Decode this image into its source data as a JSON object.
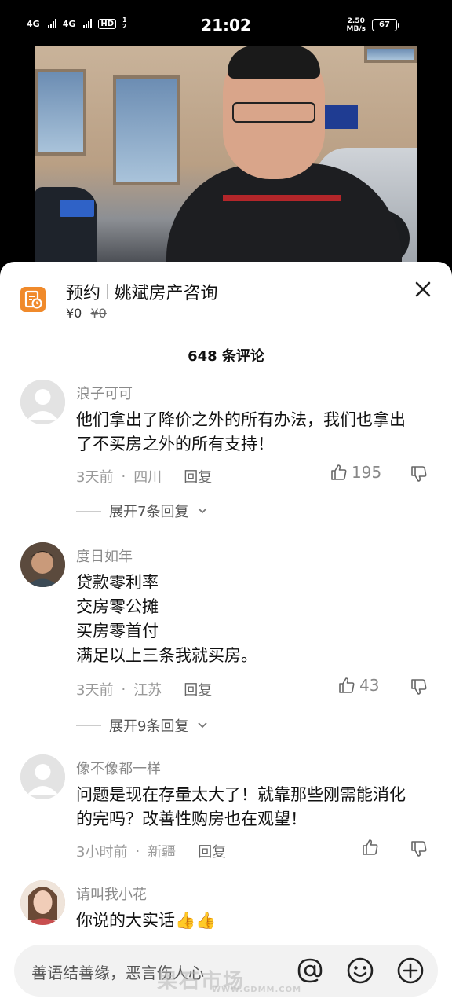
{
  "status_bar": {
    "sim1": "4G",
    "sim2": "4G",
    "hd": "HD",
    "hd_sub": "1 2",
    "time": "21:02",
    "net_speed": "2.50",
    "net_unit": "MB/s",
    "battery": "67"
  },
  "promo": {
    "tag": "预约",
    "title": "姚斌房产咨询",
    "price": "¥0",
    "original_price": "¥0"
  },
  "comments_header": {
    "count_label": "648 条评论"
  },
  "comments": [
    {
      "username": "浪子可可",
      "text": "他们拿出了降价之外的所有办法，我们也拿出了不买房之外的所有支持！",
      "time": "3天前",
      "location": "四川",
      "reply_label": "回复",
      "likes": "195",
      "expand_label": "展开7条回复"
    },
    {
      "username": "度日如年",
      "text_lines": [
        "贷款零利率",
        "交房零公摊",
        "买房零首付",
        "满足以上三条我就买房。"
      ],
      "time": "3天前",
      "location": "江苏",
      "reply_label": "回复",
      "likes": "43",
      "expand_label": "展开9条回复"
    },
    {
      "username": "像不像都一样",
      "text": "问题是现在存量太大了！就靠那些刚需能消化的完吗？改善性购房也在观望！",
      "time": "3小时前",
      "location": "新疆",
      "reply_label": "回复",
      "likes": ""
    },
    {
      "username": "请叫我小花",
      "text": "你说的大实话👍👍"
    }
  ],
  "input_bar": {
    "placeholder": "善语结善缘，恶言伤人心",
    "icons": [
      "at-icon",
      "emoji-icon",
      "add-icon"
    ]
  },
  "watermark": {
    "text": "果石市场",
    "url": "WWW.GDMM.COM"
  },
  "colors": {
    "promo_icon": "#f08a2b",
    "background": "#ffffff",
    "muted_text": "#999999"
  }
}
